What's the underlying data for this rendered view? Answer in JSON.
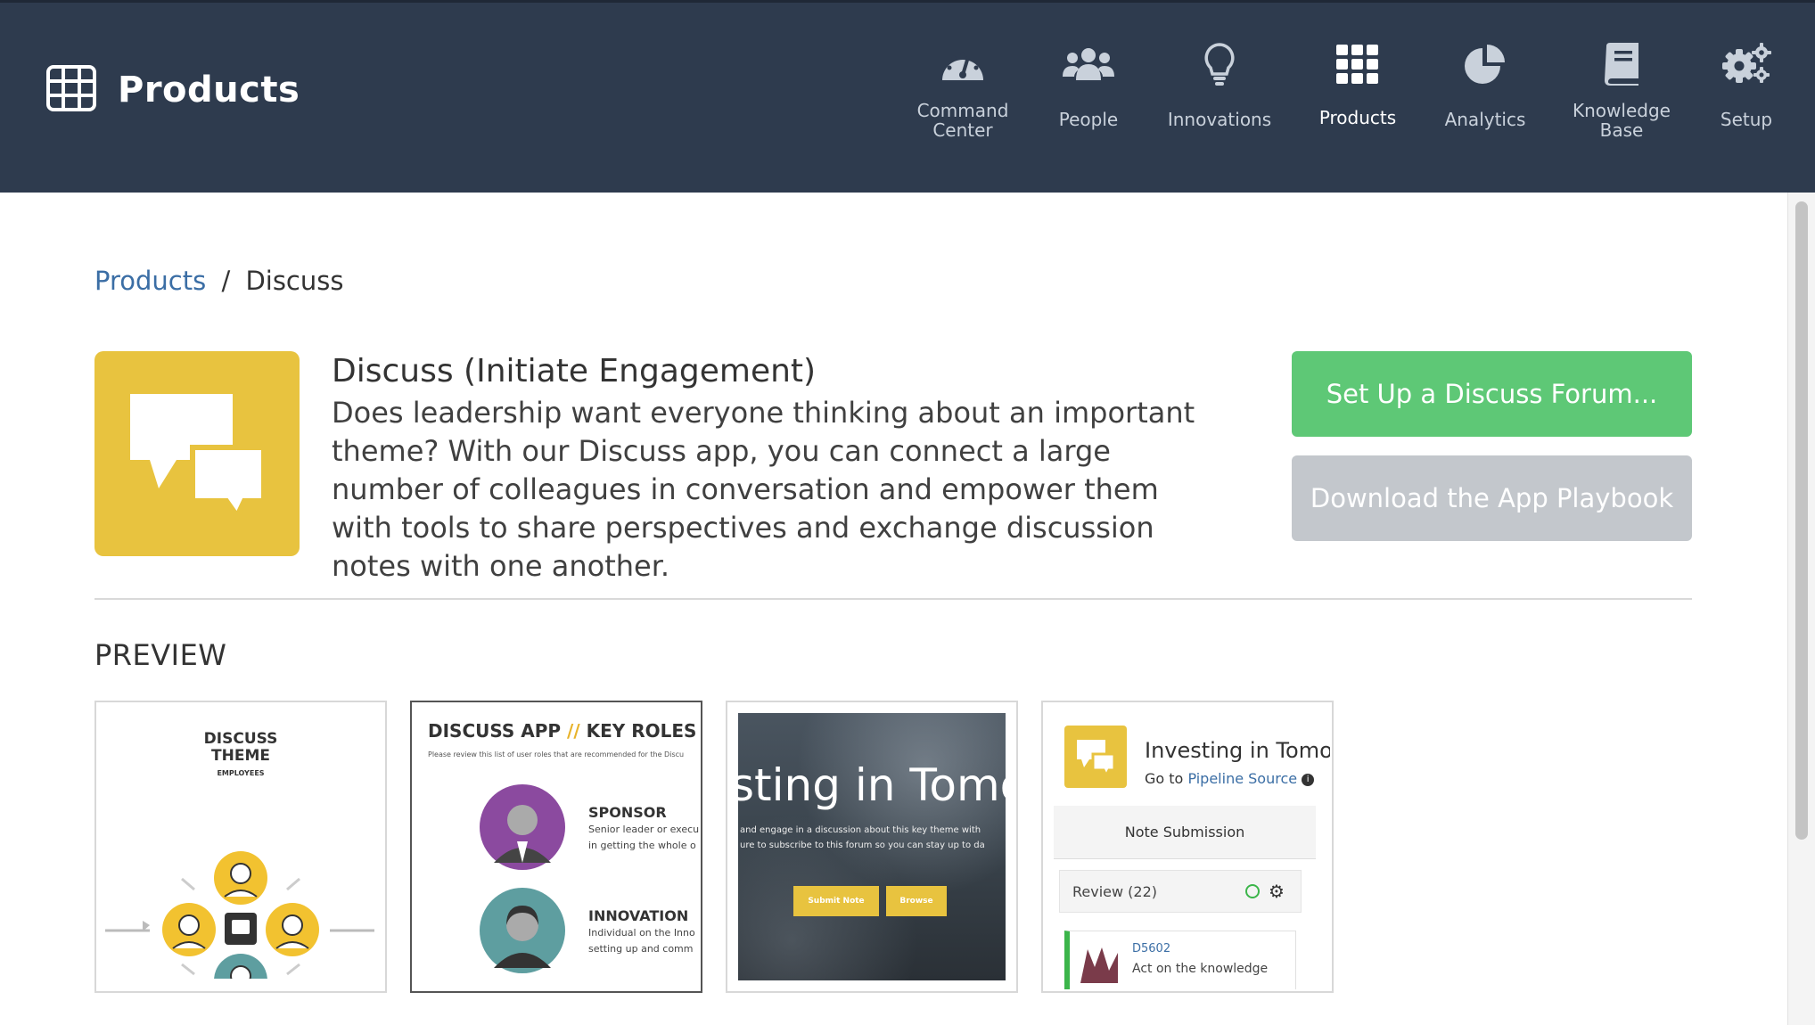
{
  "header": {
    "title": "Products",
    "nav": [
      {
        "label": "Command\nCenter",
        "icon": "gauge-icon"
      },
      {
        "label": "People",
        "icon": "people-icon"
      },
      {
        "label": "Innovations",
        "icon": "lightbulb-icon"
      },
      {
        "label": "Products",
        "icon": "grid-icon",
        "active": true
      },
      {
        "label": "Analytics",
        "icon": "pie-chart-icon"
      },
      {
        "label": "Knowledge\nBase",
        "icon": "book-icon"
      },
      {
        "label": "Setup",
        "icon": "gears-icon"
      }
    ]
  },
  "breadcrumb": {
    "parent": "Products",
    "separator": "/",
    "current": "Discuss"
  },
  "product": {
    "title": "Discuss (Initiate Engagement)",
    "description": "Does leadership want everyone thinking about an important theme? With our Discuss app, you can connect a large number of colleagues in conversation and empower them with tools to share perspectives and exchange discussion notes with one another.",
    "icon": "chat-bubbles-icon",
    "icon_color": "#e8c33f"
  },
  "actions": {
    "setup_label": "Set Up a Discuss Forum...",
    "playbook_label": "Download the App Playbook",
    "setup_color": "#5ec876",
    "playbook_color": "#c3c7cc"
  },
  "preview": {
    "title": "PREVIEW",
    "thumb1": {
      "title": "DISCUSS\nTHEME",
      "subtitle": "EMPLOYEES"
    },
    "thumb2": {
      "title": "DISCUSS APP",
      "slashes": "//",
      "title2": "KEY ROLES",
      "intro": "Please review this list of user roles that are recommended for the Discu",
      "role1": "SPONSOR",
      "role1_desc1": "Senior leader or execu",
      "role1_desc2": "in getting the whole o",
      "role2": "INNOVATION",
      "role2_desc1": "Individual on the Inno",
      "role2_desc2": "setting up and comm"
    },
    "thumb3": {
      "heading": "sting in Tomo",
      "line1": "and engage in a discussion about this key theme with",
      "line2": "ure to subscribe to this forum so you can stay up to da",
      "btn1": "Submit Note",
      "btn2": "Browse"
    },
    "thumb4": {
      "title": "Investing in Tomo",
      "goto": "Go to",
      "link": "Pipeline Source",
      "note": "Note Submission",
      "review": "Review (22)",
      "id": "D5602",
      "text": "Act on the knowledge"
    }
  }
}
